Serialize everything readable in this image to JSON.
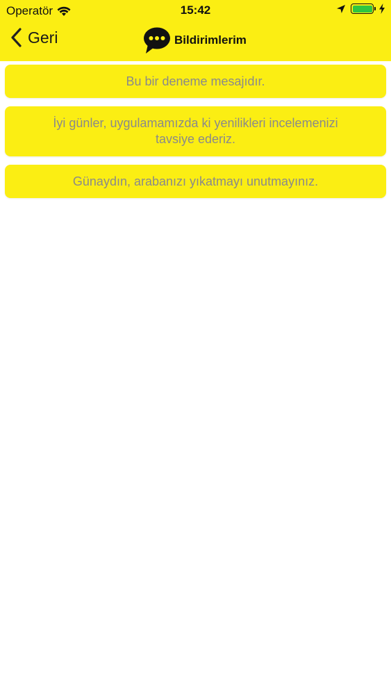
{
  "status_bar": {
    "carrier": "Operatör",
    "time": "15:42",
    "battery_level": 1.0
  },
  "nav": {
    "back_label": "Geri",
    "title": "Bildirimlerim",
    "icons": {
      "back": "chevron-left-icon",
      "title": "chat-bubble-icon"
    }
  },
  "notifications": [
    {
      "text": "Bu bir deneme mesajıdır."
    },
    {
      "text": "İyi günler, uygulamamızda ki yenilikleri incelemenizi tavsiye ederiz."
    },
    {
      "text": "Günaydın, arabanızı yıkatmayı unutmayınız."
    }
  ],
  "colors": {
    "accent": "#fbee13",
    "message_text": "#8a8a8a",
    "background": "#ffffff"
  }
}
